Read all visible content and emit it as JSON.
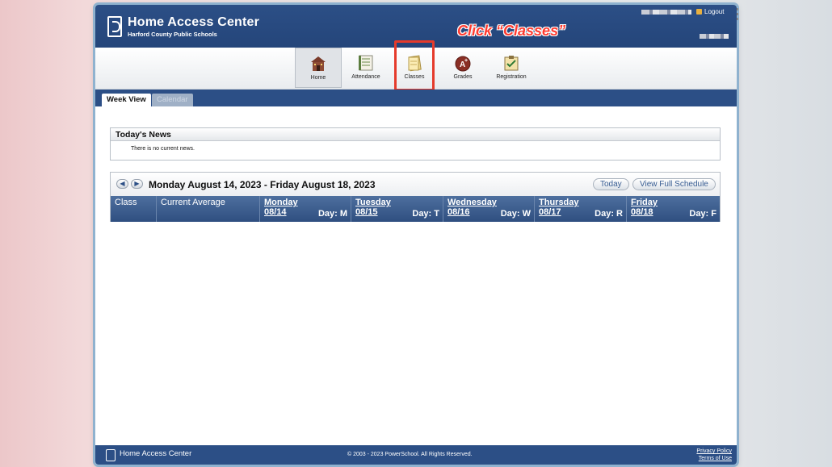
{
  "header": {
    "app_title": "Home Access Center",
    "district": "Harford County Public Schools",
    "logout": "Logout",
    "annotation": "Click “Classes”"
  },
  "nav": {
    "items": [
      {
        "label": "Home",
        "icon": "school-house-icon"
      },
      {
        "label": "Attendance",
        "icon": "attendance-book-icon"
      },
      {
        "label": "Classes",
        "icon": "classes-notebook-icon"
      },
      {
        "label": "Grades",
        "icon": "grades-apple-icon"
      },
      {
        "label": "Registration",
        "icon": "registration-clipboard-icon"
      }
    ],
    "active": "Home",
    "highlighted": "Classes"
  },
  "tabs": [
    {
      "label": "Week View",
      "state": "active"
    },
    {
      "label": "Calendar",
      "state": "inactive"
    }
  ],
  "news": {
    "title": "Today's News",
    "message": "There is no current news."
  },
  "schedule": {
    "range": "Monday August 14, 2023 - Friday August 18, 2023",
    "today_button": "Today",
    "full_schedule_button": "View Full Schedule",
    "columns": {
      "class": "Class",
      "current_average": "Current Average"
    },
    "days": [
      {
        "name": "Monday",
        "date": "08/14",
        "day_code": "Day: M"
      },
      {
        "name": "Tuesday",
        "date": "08/15",
        "day_code": "Day: T"
      },
      {
        "name": "Wednesday",
        "date": "08/16",
        "day_code": "Day: W"
      },
      {
        "name": "Thursday",
        "date": "08/17",
        "day_code": "Day: R"
      },
      {
        "name": "Friday",
        "date": "08/18",
        "day_code": "Day: F"
      }
    ]
  },
  "footer": {
    "title": "Home Access Center",
    "copyright": "© 2003 - 2023 PowerSchool. All Rights Reserved.",
    "privacy": "Privacy Policy",
    "terms": "Terms of Use"
  },
  "colors": {
    "header_blue": "#2c4f86",
    "annotation_red": "#e53b2c"
  }
}
